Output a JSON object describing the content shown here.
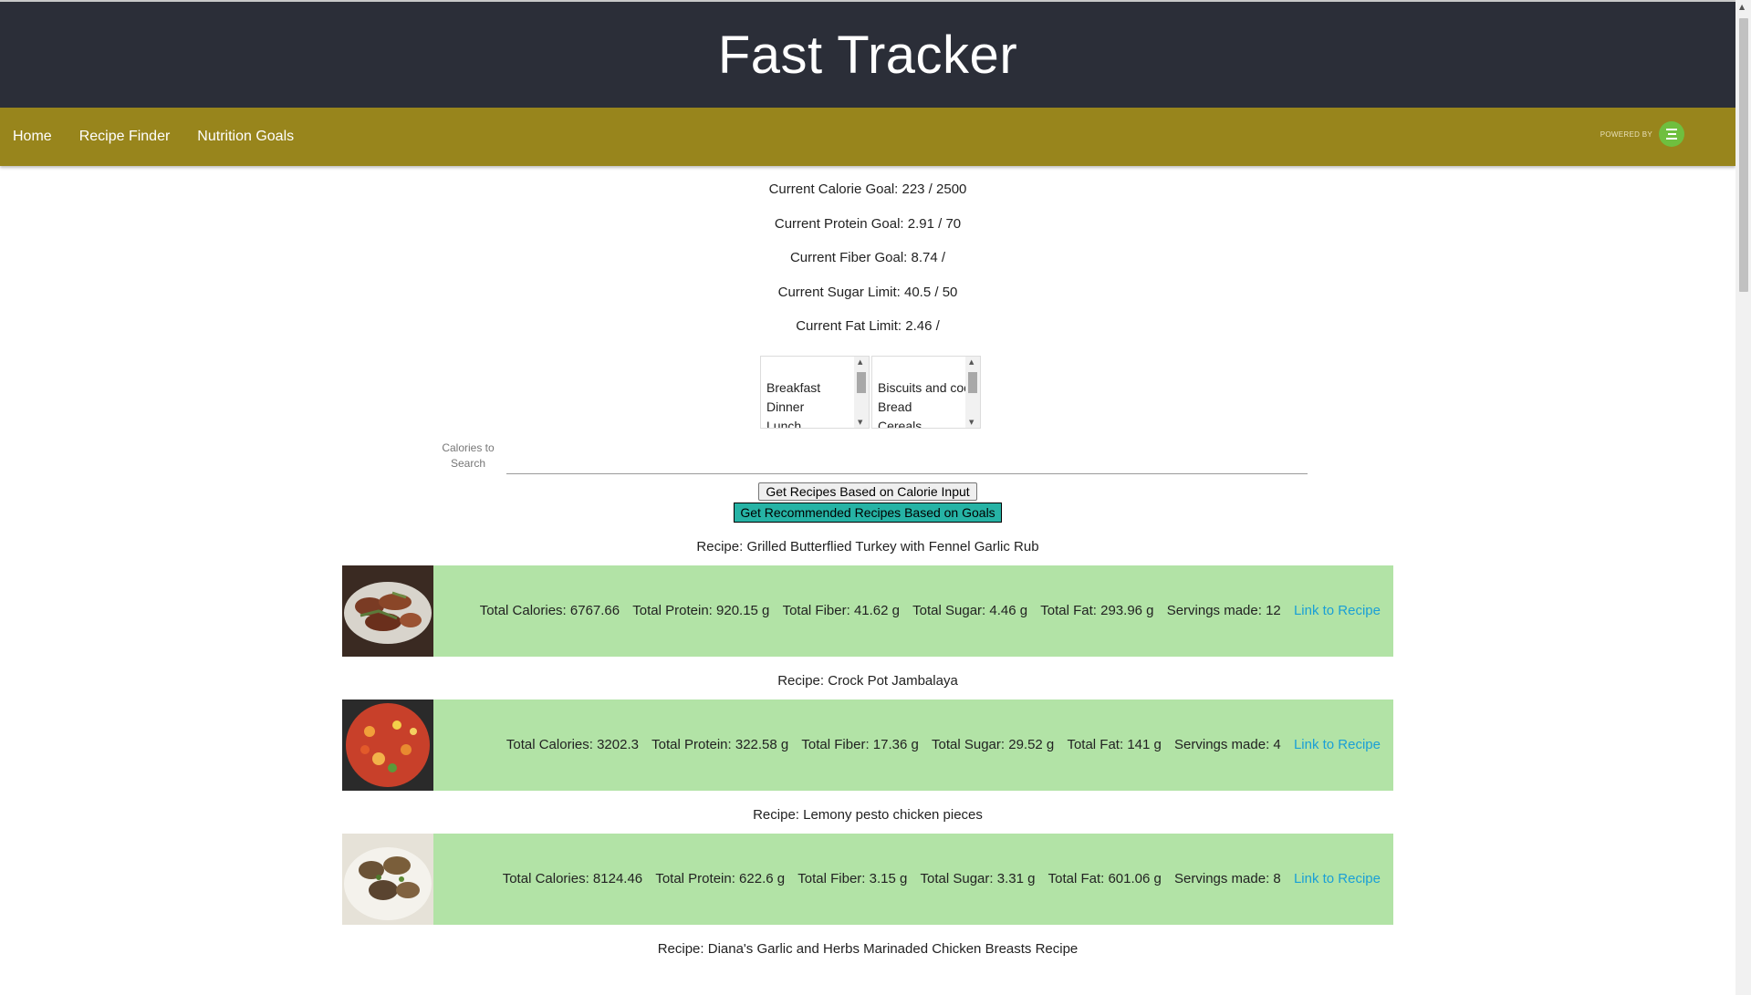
{
  "app": {
    "title": "Fast Tracker"
  },
  "nav": {
    "items": [
      "Home",
      "Recipe Finder",
      "Nutrition Goals"
    ],
    "powered_by": "POWERED BY",
    "logo_icon": "edamam-logo-icon"
  },
  "goals": {
    "calorie": "Current Calorie Goal: 223 / 2500",
    "protein": "Current Protein Goal: 2.91 / 70",
    "fiber": "Current Fiber Goal: 8.74 /",
    "sugar": "Current Sugar Limit: 40.5 / 50",
    "fat": "Current Fat Limit: 2.46 /"
  },
  "meal_types": [
    "Breakfast",
    "Dinner",
    "Lunch"
  ],
  "dish_types": [
    "Biscuits and cookies",
    "Bread",
    "Cereals"
  ],
  "search": {
    "label": "Calories to Search",
    "value": ""
  },
  "buttons": {
    "calorie_search": "Get Recipes Based on Calorie Input",
    "recommended": "Get Recommended Recipes Based on Goals"
  },
  "recipes": [
    {
      "title": "Recipe: Grilled Butterflied Turkey with Fennel Garlic Rub",
      "calories": "Total Calories: 6767.66",
      "protein": "Total Protein: 920.15 g",
      "fiber": "Total Fiber: 41.62 g",
      "sugar": "Total Sugar: 4.46 g",
      "fat": "Total Fat: 293.96 g",
      "servings": "Servings made: 12",
      "link": "Link to Recipe"
    },
    {
      "title": "Recipe: Crock Pot Jambalaya",
      "calories": "Total Calories: 3202.3",
      "protein": "Total Protein: 322.58 g",
      "fiber": "Total Fiber: 17.36 g",
      "sugar": "Total Sugar: 29.52 g",
      "fat": "Total Fat: 141 g",
      "servings": "Servings made: 4",
      "link": "Link to Recipe"
    },
    {
      "title": "Recipe: Lemony pesto chicken pieces",
      "calories": "Total Calories: 8124.46",
      "protein": "Total Protein: 622.6 g",
      "fiber": "Total Fiber: 3.15 g",
      "sugar": "Total Sugar: 3.31 g",
      "fat": "Total Fat: 601.06 g",
      "servings": "Servings made: 8",
      "link": "Link to Recipe"
    }
  ],
  "partial_recipe": {
    "title": "Recipe: Diana's Garlic and Herbs Marinaded Chicken Breasts Recipe"
  },
  "colors": {
    "header_bg": "#2b2e38",
    "nav_bg": "#98851c",
    "row_bg": "#b2e3a6",
    "accent_button": "#26b3a5",
    "link": "#1a9fd6"
  }
}
